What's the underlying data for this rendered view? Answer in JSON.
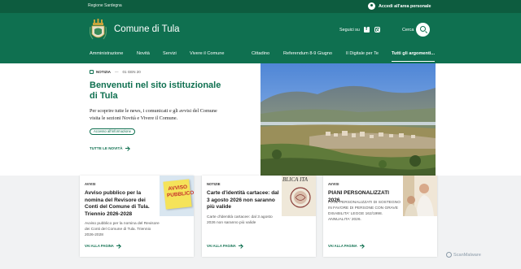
{
  "slim_header": {
    "region": "Regione Sardegna",
    "login_label": "Accedi all'area personale"
  },
  "header": {
    "site_title": "Comune di Tula",
    "social_label": "Seguici su",
    "search_label": "Cerca"
  },
  "nav": {
    "items": [
      {
        "label": "Amministrazione"
      },
      {
        "label": "Novità"
      },
      {
        "label": "Servizi"
      },
      {
        "label": "Vivere il Comune"
      },
      {
        "label": "Cittadino"
      },
      {
        "label": "Referendum 8-9 Giugno"
      },
      {
        "label": "Il Digitale per Te"
      },
      {
        "label": "Tutti gli argomenti..."
      }
    ]
  },
  "hero": {
    "tag": "NOTIZIA",
    "date": "01 GEN 20",
    "title": "Benvenuti nel sito istituzionale di Tula",
    "description": "Per scoprire tutte le news, i comunicati e gli avvisi del Comune visita le sezioni Novità e Vivere il Comune.",
    "chip": "Accesso all'informazione",
    "all_news": "TUTTE LE NOVITÀ"
  },
  "cards": [
    {
      "category": "AVVISI",
      "title": "Avviso pubblico per la nomina del Revisore dei Conti del Comune di Tula. Triennio 2026-2028",
      "description": "Avviso pubblico per la nomina del Revisore dei Conti del Comune di Tula. Triennio 2026-2028",
      "link": "VAI ALLA PAGINA",
      "thumb_text": "AVVISO PUBBLICO"
    },
    {
      "category": "NOTIZIE",
      "title": "Carte d'identità cartacee: dal 3 agosto 2026 non saranno più valide",
      "description": "Carte d'identità cartacee: dal 3 agosto 2026 non saranno più valide",
      "link": "VAI ALLA PAGINA",
      "thumb_text": "BLICA ITA"
    },
    {
      "category": "AVVISI",
      "title": "PIANI PERSONALIZZATI 2026",
      "description": "PIANI PERSONALIZZATI DI SOSTEGNO IN FAVORE DI PERSONE CON GRAVE DISABILITA' LEGGE 162/1998. ANNUALITA' 2026.",
      "link": "VAI ALLA PAGINA"
    }
  ],
  "watermark": "ScanMalware",
  "colors": {
    "brand_green": "#0f7050",
    "dark_green": "#0d5c3f"
  }
}
